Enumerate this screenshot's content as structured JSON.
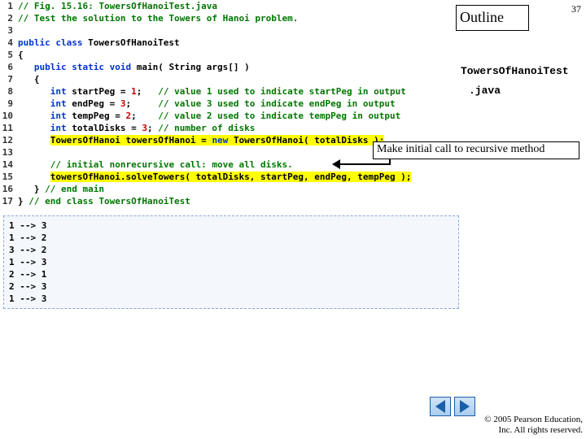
{
  "page_number": "37",
  "outline_label": "Outline",
  "file_name_line1": "TowersOfHanoiTest",
  "file_name_line2": ".java",
  "callout_text": "Make initial call to recursive method",
  "copyright_line1": "© 2005 Pearson Education,",
  "copyright_line2": "Inc.  All rights reserved.",
  "code": [
    {
      "n": "1",
      "segs": [
        {
          "t": "// Fig. 15.16: TowersOfHanoiTest.java",
          "cls": "c-green"
        }
      ]
    },
    {
      "n": "2",
      "segs": [
        {
          "t": "// Test the solution to the Towers of Hanoi problem.",
          "cls": "c-green"
        }
      ]
    },
    {
      "n": "3",
      "segs": []
    },
    {
      "n": "4",
      "segs": [
        {
          "t": "public class ",
          "cls": "c-blue"
        },
        {
          "t": "TowersOfHanoiTest",
          "cls": "c-black"
        }
      ]
    },
    {
      "n": "5",
      "segs": [
        {
          "t": "{",
          "cls": "c-black"
        }
      ]
    },
    {
      "n": "6",
      "segs": [
        {
          "t": "   public static void ",
          "cls": "c-blue"
        },
        {
          "t": "main( String args[] )",
          "cls": "c-black"
        }
      ]
    },
    {
      "n": "7",
      "segs": [
        {
          "t": "   {",
          "cls": "c-black"
        }
      ]
    },
    {
      "n": "8",
      "segs": [
        {
          "t": "      int ",
          "cls": "c-blue"
        },
        {
          "t": "startPeg = ",
          "cls": "c-black"
        },
        {
          "t": "1",
          "cls": "c-red"
        },
        {
          "t": ";   ",
          "cls": "c-black"
        },
        {
          "t": "// value 1 used to indicate startPeg in output",
          "cls": "c-green"
        }
      ]
    },
    {
      "n": "9",
      "segs": [
        {
          "t": "      int ",
          "cls": "c-blue"
        },
        {
          "t": "endPeg = ",
          "cls": "c-black"
        },
        {
          "t": "3",
          "cls": "c-red"
        },
        {
          "t": ";     ",
          "cls": "c-black"
        },
        {
          "t": "// value 3 used to indicate endPeg in output",
          "cls": "c-green"
        }
      ]
    },
    {
      "n": "10",
      "segs": [
        {
          "t": "      int ",
          "cls": "c-blue"
        },
        {
          "t": "tempPeg = ",
          "cls": "c-black"
        },
        {
          "t": "2",
          "cls": "c-red"
        },
        {
          "t": ";    ",
          "cls": "c-black"
        },
        {
          "t": "// value 2 used to indicate tempPeg in output",
          "cls": "c-green"
        }
      ]
    },
    {
      "n": "11",
      "segs": [
        {
          "t": "      int ",
          "cls": "c-blue"
        },
        {
          "t": "totalDisks = ",
          "cls": "c-black"
        },
        {
          "t": "3",
          "cls": "c-red"
        },
        {
          "t": "; ",
          "cls": "c-black"
        },
        {
          "t": "// number of disks",
          "cls": "c-green"
        }
      ]
    },
    {
      "n": "12",
      "segs": [
        {
          "t": "      ",
          "cls": ""
        },
        {
          "t": "TowersOfHanoi towersOfHanoi = ",
          "cls": "c-black hl"
        },
        {
          "t": "new ",
          "cls": "c-blue hl"
        },
        {
          "t": "TowersOfHanoi( totalDisks );",
          "cls": "c-black hl"
        }
      ]
    },
    {
      "n": "13",
      "segs": []
    },
    {
      "n": "14",
      "segs": [
        {
          "t": "      ",
          "cls": ""
        },
        {
          "t": "// initial nonrecursive call: move all disks.",
          "cls": "c-green"
        }
      ]
    },
    {
      "n": "15",
      "segs": [
        {
          "t": "      ",
          "cls": ""
        },
        {
          "t": "towersOfHanoi.solveTowers( totalDisks, startPeg, endPeg, tempPeg );",
          "cls": "c-black hl"
        }
      ]
    },
    {
      "n": "16",
      "segs": [
        {
          "t": "   } ",
          "cls": "c-black"
        },
        {
          "t": "// end main",
          "cls": "c-green"
        }
      ]
    },
    {
      "n": "17",
      "segs": [
        {
          "t": "} ",
          "cls": "c-black"
        },
        {
          "t": "// end class TowersOfHanoiTest",
          "cls": "c-green"
        }
      ]
    }
  ],
  "output_text": "1 --> 3\n1 --> 2\n3 --> 2\n1 --> 3\n2 --> 1\n2 --> 3\n1 --> 3"
}
